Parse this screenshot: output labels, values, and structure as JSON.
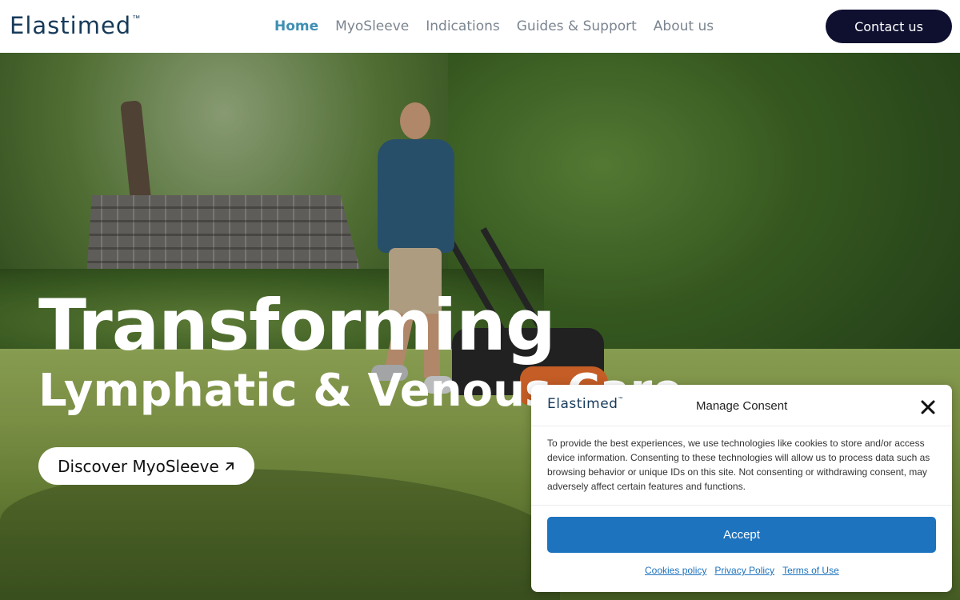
{
  "header": {
    "logo_text": "Elastimed",
    "logo_tm": "™",
    "nav": [
      {
        "label": "Home",
        "active": true
      },
      {
        "label": "MyoSleeve",
        "active": false
      },
      {
        "label": "Indications",
        "active": false
      },
      {
        "label": "Guides & Support",
        "active": false
      },
      {
        "label": "About us",
        "active": false
      }
    ],
    "contact_label": "Contact us"
  },
  "hero": {
    "title": "Transforming",
    "subtitle": "Lymphatic & Venous Care",
    "cta_label": "Discover MyoSleeve"
  },
  "consent": {
    "logo_text": "Elastimed",
    "logo_tm": "™",
    "title": "Manage Consent",
    "body": "To provide the best experiences, we use technologies like cookies to store and/or access device information. Consenting to these technologies will allow us to process data such as browsing behavior or unique IDs on this site. Not consenting or withdrawing consent, may adversely affect certain features and functions.",
    "accept_label": "Accept",
    "links": [
      "Cookies policy",
      "Privacy Policy",
      "Terms of Use"
    ]
  },
  "colors": {
    "brand_navy": "#0f1030",
    "nav_active": "#3f8fb3",
    "accept_blue": "#1e73be"
  },
  "icons": [
    "close-icon",
    "arrow-up-right-icon"
  ]
}
